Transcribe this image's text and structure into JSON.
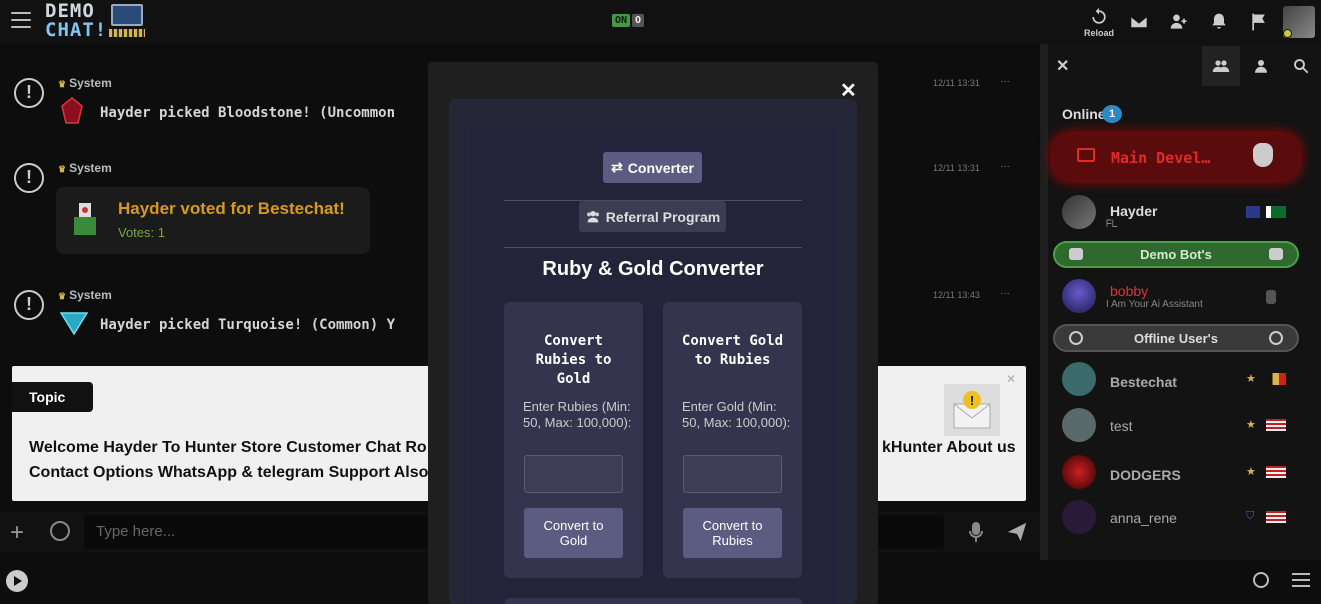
{
  "header": {
    "logo_line1": "DEMO",
    "logo_line2": "CHAT!",
    "toggle_on": "ON",
    "toggle_off": "O",
    "reload_label": "Reload"
  },
  "messages": [
    {
      "user": "System",
      "time": "12/11 13:31",
      "text": "Hayder picked Bloodstone! (Uncommon"
    },
    {
      "user": "System",
      "time": "12/11 13:31",
      "vote_title": "Hayder voted for Bestechat!",
      "vote_sub": "Votes: 1"
    },
    {
      "user": "System",
      "time": "12/11 13:43",
      "text": "Hayder picked Turquoise! (Common) Y"
    }
  ],
  "topic": {
    "label": "Topic",
    "line1": "Welcome Hayder To Hunter Store Customer Chat Ro",
    "line2": "Contact Options WhatsApp & telegram Support Also",
    "line1_end": "kHunter About us"
  },
  "input": {
    "placeholder": "Type here..."
  },
  "sidebar": {
    "online_label": "Online",
    "online_count": "1",
    "main_dev": "Main Devel…",
    "demo_bots": "Demo Bot's",
    "offline_users": "Offline User's",
    "users": [
      {
        "name": "Hayder",
        "sub": "ᖴᒪ"
      },
      {
        "name": "bobby",
        "sub": "I Am Your Ai Assistant"
      },
      {
        "name": "Bestechat"
      },
      {
        "name": "test"
      },
      {
        "name": "DODGERS"
      },
      {
        "name": "anna_rene"
      }
    ]
  },
  "modal": {
    "tab_converter": "Converter",
    "tab_referral": "Referral Program",
    "title": "Ruby & Gold Converter",
    "card1_title": "Convert Rubies to Gold",
    "card1_label": "Enter Rubies (Min: 50, Max: 100,000):",
    "card1_button": "Convert to Gold",
    "card2_title": "Convert Gold to Rubies",
    "card2_label": "Enter Gold (Min: 50, Max: 100,000):",
    "card2_button": "Convert to Rubies"
  }
}
